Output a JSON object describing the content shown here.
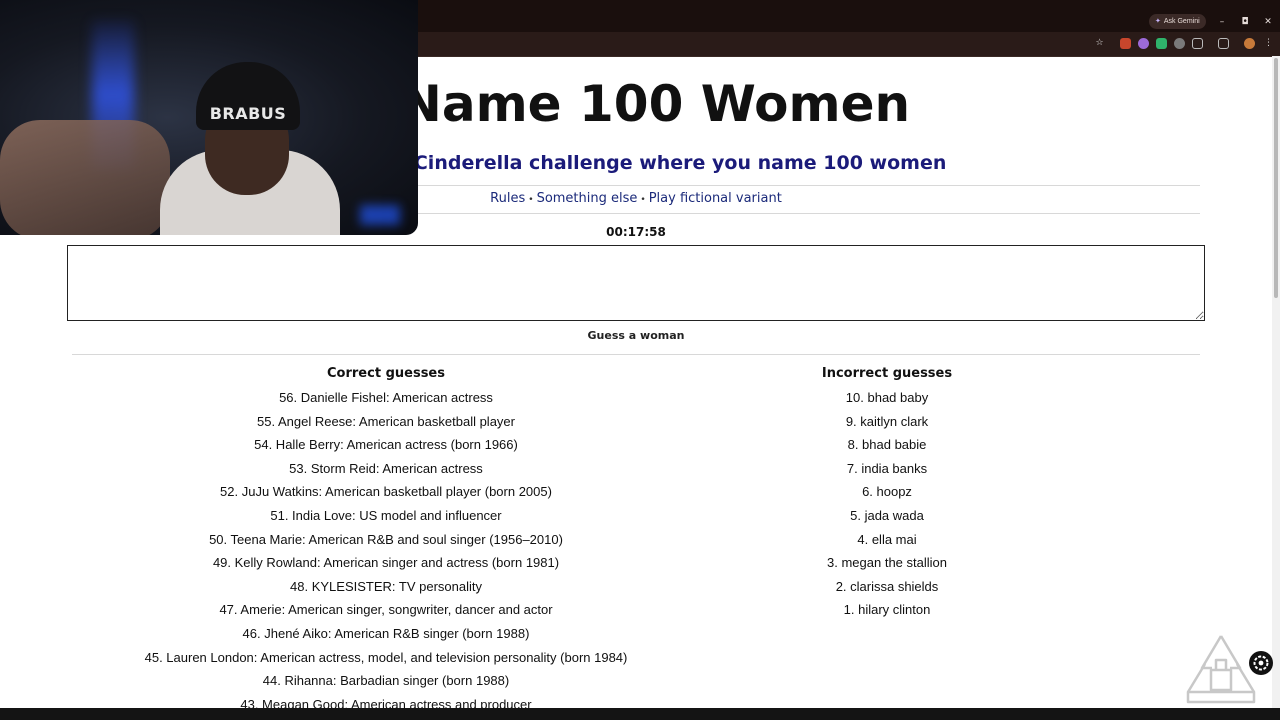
{
  "browser": {
    "ask_gemini": "Ask Gemini",
    "minimize": "–",
    "restore": "◘",
    "close": "✕"
  },
  "page": {
    "title": "Name 100 Women",
    "subtitle": "that QTCinderella challenge where you name 100 women",
    "nav": {
      "rules": "Rules",
      "something_else": "Something else",
      "fictional": "Play fictional variant",
      "separator": "•"
    },
    "timer": "00:17:58",
    "guess_input_value": "",
    "guess_label": "Guess a woman"
  },
  "correct": {
    "heading": "Correct guesses",
    "items": [
      "56. Danielle Fishel: American actress",
      "55. Angel Reese: American basketball player",
      "54. Halle Berry: American actress (born 1966)",
      "53. Storm Reid: American actress",
      "52. JuJu Watkins: American basketball player (born 2005)",
      "51. India Love: US model and influencer",
      "50. Teena Marie: American R&B and soul singer (1956–2010)",
      "49. Kelly Rowland: American singer and actress (born 1981)",
      "48. KYLESISTER: TV personality",
      "47. Amerie: American singer, songwriter, dancer and actor",
      "46. Jhené Aiko: American R&B singer (born 1988)",
      "45. Lauren London: American actress, model, and television personality (born 1984)",
      "44. Rihanna: Barbadian singer (born 1988)",
      "43. Meagan Good: American actress and producer"
    ]
  },
  "incorrect": {
    "heading": "Incorrect guesses",
    "items": [
      "10. bhad baby",
      "9. kaitlyn clark",
      "8. bhad babie",
      "7. india banks",
      "6. hoopz",
      "5. jada wada",
      "4. ella mai",
      "3. megan the stallion",
      "2. clarissa shields",
      "1. hilary clinton"
    ]
  },
  "webcam": {
    "beanie_text": "BRABUS"
  },
  "icons": [
    "star-icon",
    "extension-icon",
    "puzzle-icon",
    "profile-icon",
    "recycle-icon",
    "settings-icon"
  ]
}
